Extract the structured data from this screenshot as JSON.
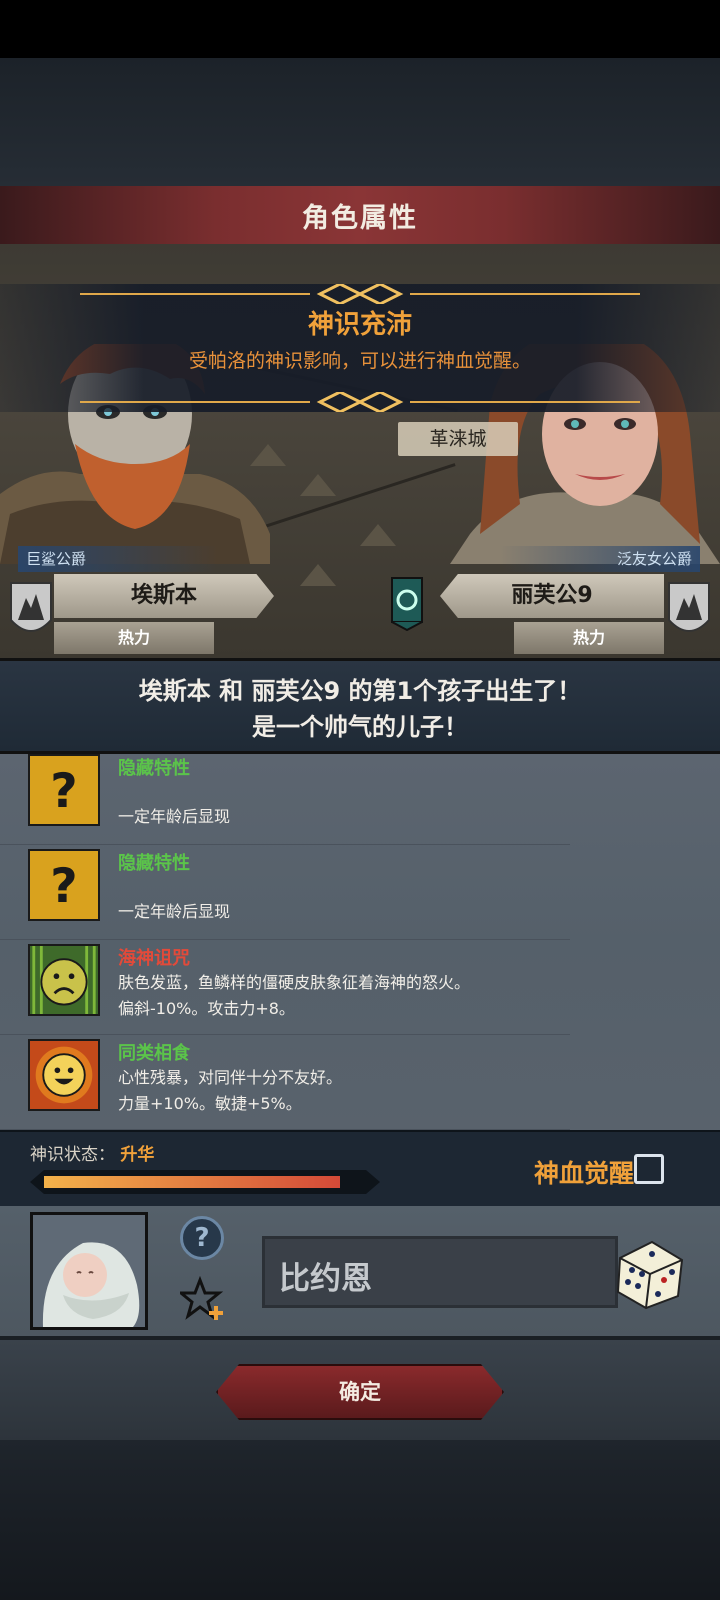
{
  "header": {
    "title": "角色属性"
  },
  "banner": {
    "title": "神识充沛",
    "description": "受帕洛的神识影响，可以进行神血觉醒。"
  },
  "map": {
    "city": "革涞城"
  },
  "father": {
    "title": "巨鲨公爵",
    "name": "埃斯本",
    "trait": "热力"
  },
  "mother": {
    "title": "泛友女公爵",
    "name": "丽芙公9",
    "trait": "热力"
  },
  "announcement": {
    "line1": "埃斯本 和 丽芙公9 的第1个孩子出生了！",
    "line2": "是一个帅气的儿子！"
  },
  "traits": [
    {
      "name": "隐藏特性",
      "name_color": "#5bc44a",
      "desc1": "",
      "desc2": "一定年龄后显现",
      "icon": "question-mark-icon"
    },
    {
      "name": "隐藏特性",
      "name_color": "#5bc44a",
      "desc1": "",
      "desc2": "一定年龄后显现",
      "icon": "question-mark-icon"
    },
    {
      "name": "海神诅咒",
      "name_color": "#e24a3a",
      "desc1": "肤色发蓝，鱼鳞样的僵硬皮肤象征着海神的怒火。",
      "desc2": "偏斜-10%。攻击力+8。",
      "icon": "sad-face-icon"
    },
    {
      "name": "同类相食",
      "name_color": "#5bc44a",
      "desc1": "心性残暴，对同伴十分不友好。",
      "desc2": "力量+10%。敏捷+5%。",
      "icon": "smiling-sun-icon"
    }
  ],
  "status": {
    "label": "神识状态：",
    "value": "升华",
    "progress": 0.92,
    "awaken_label": "神血觉醒",
    "awaken_checked": false
  },
  "child": {
    "name": "比约恩"
  },
  "actions": {
    "confirm": "确定"
  },
  "colors": {
    "accent_orange": "#f0a13a",
    "panel_dark": "#1d2733",
    "button_red": "#8a2a2c"
  }
}
